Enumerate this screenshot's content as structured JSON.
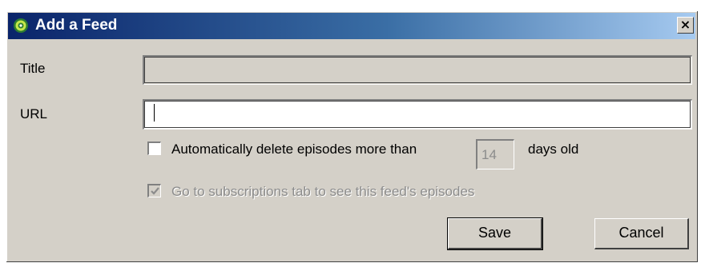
{
  "window": {
    "title": "Add a Feed",
    "close_label": "×"
  },
  "form": {
    "title_label": "Title",
    "title_value": "",
    "url_label": "URL",
    "url_value": "",
    "auto_delete_label": "Automatically delete episodes more than",
    "auto_delete_checked": false,
    "days_value": "14",
    "days_suffix": "days old",
    "goto_subscriptions_label": "Go to subscriptions tab to see this feed's episodes",
    "goto_subscriptions_checked": true,
    "goto_subscriptions_enabled": false
  },
  "buttons": {
    "save_label": "Save",
    "cancel_label": "Cancel"
  },
  "colors": {
    "titlebar_start": "#0a246a",
    "titlebar_end": "#a6caf0",
    "dialog_bg": "#d4d0c8",
    "disabled_text": "#8c8c8c"
  },
  "icons": {
    "app": "feed-icon",
    "close": "close-icon",
    "check": "check-icon"
  }
}
